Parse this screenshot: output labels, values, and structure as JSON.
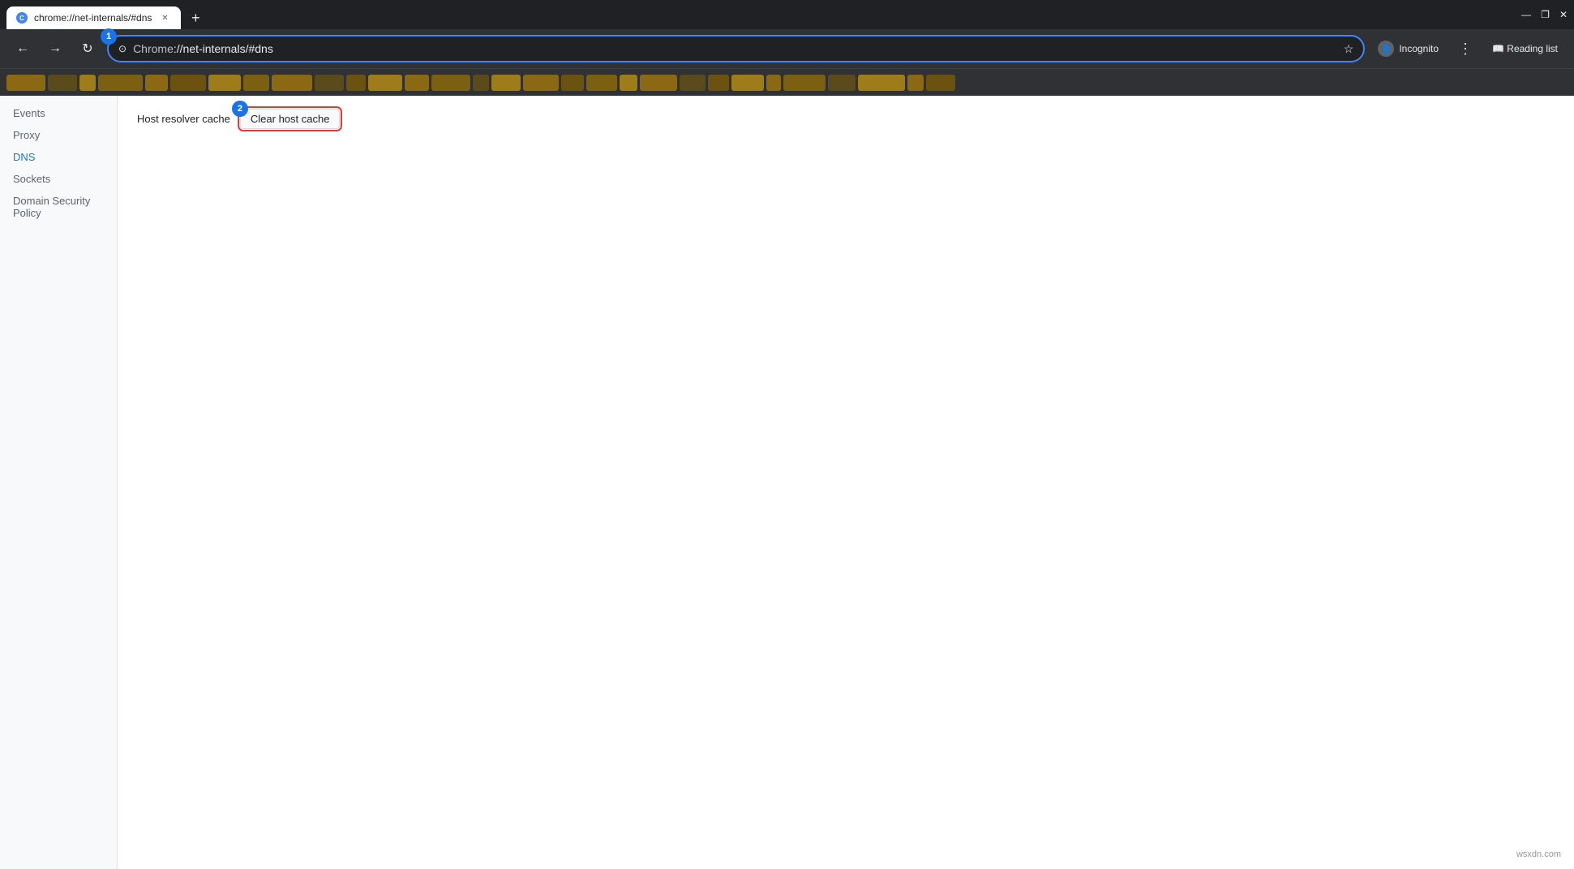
{
  "titleBar": {
    "tab": {
      "favicon": "C",
      "title": "chrome://net-internals/#dns",
      "close": "✕"
    },
    "newTab": "+",
    "controls": {
      "minimize": "—",
      "restore": "❐",
      "close": "✕"
    }
  },
  "navBar": {
    "back": "←",
    "forward": "→",
    "refresh": "↻",
    "addressBar": {
      "lock": "⊙",
      "url": "chrome://net-internals/#dns",
      "urlPrefix": "Chrome",
      "urlHighlight": "://net-internals/#dns"
    },
    "annotation1": "1",
    "star": "☆",
    "incognito": "Incognito",
    "menu": "⋮",
    "readingList": "📖 Reading list"
  },
  "sidebar": {
    "items": [
      {
        "label": "Events",
        "active": false
      },
      {
        "label": "Proxy",
        "active": false
      },
      {
        "label": "DNS",
        "active": true
      },
      {
        "label": "Sockets",
        "active": false
      },
      {
        "label": "Domain Security Policy",
        "active": false
      }
    ]
  },
  "mainPanel": {
    "hostResolverLabel": "Host resolver cache",
    "clearHostCacheButton": "Clear host cache",
    "annotation2": "2"
  },
  "watermark": "wsxdn.com"
}
